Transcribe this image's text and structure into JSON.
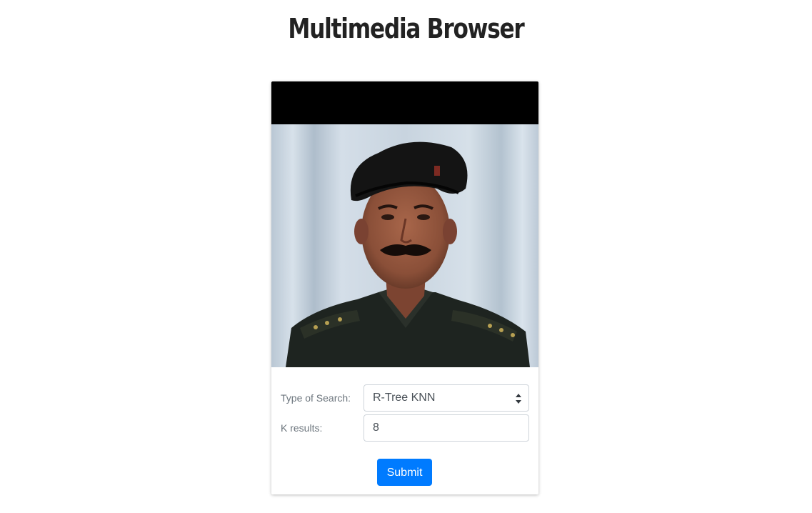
{
  "page": {
    "title": "Multimedia Browser"
  },
  "image": {
    "description_icon": "portrait-photo"
  },
  "form": {
    "search_type": {
      "label": "Type of Search:",
      "selected": "R-Tree KNN"
    },
    "k_results": {
      "label": "K results:",
      "value": "8"
    },
    "submit_label": "Submit"
  },
  "colors": {
    "accent": "#007bff",
    "title": "#222222",
    "label": "#6c757d"
  }
}
